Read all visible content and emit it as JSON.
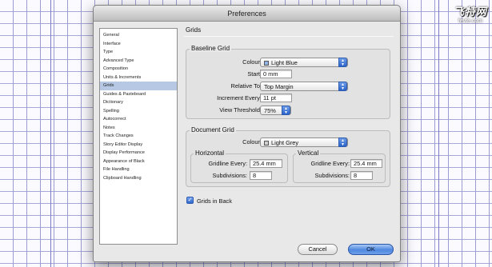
{
  "watermark": {
    "logo": "飞特网",
    "site": "fevte.com"
  },
  "window": {
    "title": "Preferences"
  },
  "sidebar": {
    "items": [
      {
        "label": "General"
      },
      {
        "label": "Interface"
      },
      {
        "label": "Type"
      },
      {
        "label": "Advanced Type"
      },
      {
        "label": "Composition"
      },
      {
        "label": "Units & Increments"
      },
      {
        "label": "Grids",
        "selected": true
      },
      {
        "label": "Guides & Pasteboard"
      },
      {
        "label": "Dictionary"
      },
      {
        "label": "Spelling"
      },
      {
        "label": "Autocorrect"
      },
      {
        "label": "Notes"
      },
      {
        "label": "Track Changes"
      },
      {
        "label": "Story Editor Display"
      },
      {
        "label": "Display Performance"
      },
      {
        "label": "Appearance of Black"
      },
      {
        "label": "File Handling"
      },
      {
        "label": "Clipboard Handling"
      }
    ]
  },
  "panel": {
    "title": "Grids",
    "baseline": {
      "title": "Baseline Grid",
      "colour_label": "Colour:",
      "colour_value": "Light Blue",
      "colour_swatch": "#8fb4e8",
      "start_label": "Start:",
      "start_value": "0 mm",
      "relative_label": "Relative To:",
      "relative_value": "Top Margin",
      "increment_label": "Increment Every:",
      "increment_value": "11 pt",
      "threshold_label": "View Threshold:",
      "threshold_value": "75%"
    },
    "document": {
      "title": "Document Grid",
      "colour_label": "Colour:",
      "colour_value": "Light Grey",
      "colour_swatch": "#cfcfcf",
      "horizontal": {
        "title": "Horizontal",
        "gridline_label": "Gridline Every:",
        "gridline_value": "25.4 mm",
        "subdivisions_label": "Subdivisions:",
        "subdivisions_value": "8"
      },
      "vertical": {
        "title": "Vertical",
        "gridline_label": "Gridline Every:",
        "gridline_value": "25.4 mm",
        "subdivisions_label": "Subdivisions:",
        "subdivisions_value": "8"
      }
    },
    "grids_in_back": {
      "label": "Grids in Back",
      "checked": true
    }
  },
  "buttons": {
    "cancel": "Cancel",
    "ok": "OK"
  }
}
